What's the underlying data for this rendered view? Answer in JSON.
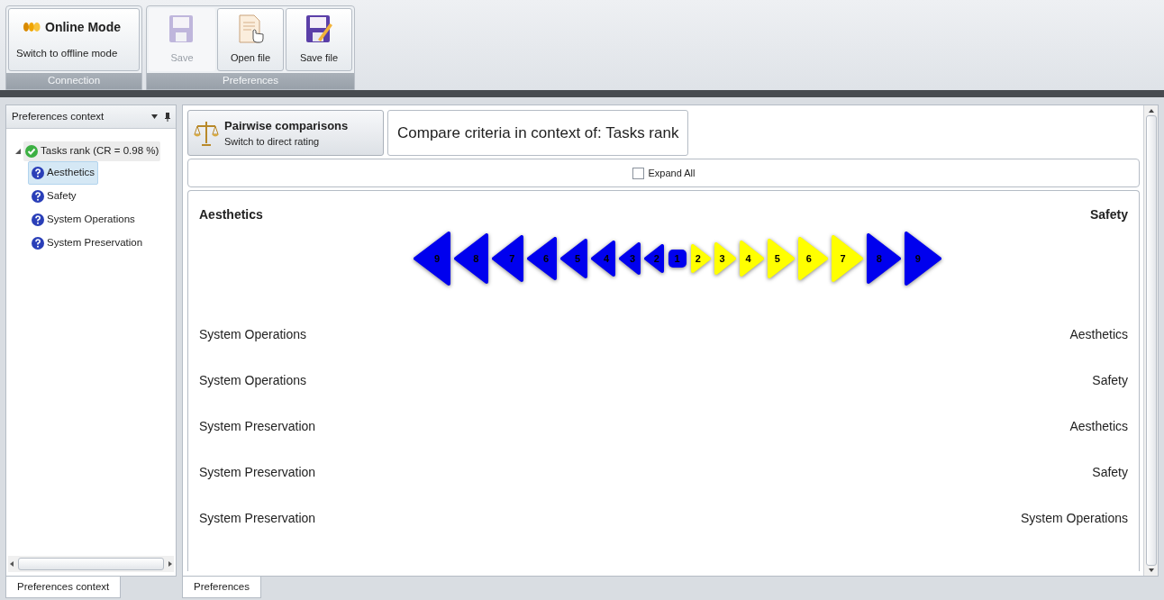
{
  "ribbon": {
    "groups": [
      {
        "label": "Connection",
        "buttons": [
          {
            "kind": "mode",
            "title": "Online Mode",
            "subtitle": "Switch to offline mode",
            "disabled": false
          }
        ]
      },
      {
        "label": "Preferences",
        "buttons": [
          {
            "kind": "floppy",
            "label": "Save",
            "disabled": true
          },
          {
            "kind": "document",
            "label": "Open file",
            "disabled": false
          },
          {
            "kind": "floppy-edit",
            "label": "Save file",
            "disabled": false
          }
        ]
      }
    ]
  },
  "left_panel": {
    "title": "Preferences context",
    "tree": [
      {
        "label": "Tasks rank (CR = 0.98 %)",
        "kind": "ok",
        "expanded": true,
        "selected": false,
        "children": [
          {
            "label": "Aesthetics",
            "kind": "unknown",
            "selected": true
          },
          {
            "label": "Safety",
            "kind": "unknown",
            "selected": false
          },
          {
            "label": "System Operations",
            "kind": "unknown",
            "selected": false
          },
          {
            "label": "System Preservation",
            "kind": "unknown",
            "selected": false
          }
        ]
      }
    ]
  },
  "main": {
    "mode_button": {
      "title": "Pairwise comparisons",
      "subtitle": "Switch to direct rating"
    },
    "context_title": "Compare criteria in context of: Tasks rank",
    "expand_all": {
      "label": "Expand All",
      "checked": false
    },
    "comparisons": [
      {
        "left": "Aesthetics",
        "right": "Safety",
        "expanded": true,
        "scale": [
          {
            "label": "9",
            "kind": "left",
            "color": "#0000ee"
          },
          {
            "label": "8",
            "kind": "left",
            "color": "#0000ee"
          },
          {
            "label": "7",
            "kind": "left",
            "color": "#0000ee"
          },
          {
            "label": "6",
            "kind": "left",
            "color": "#0000ee"
          },
          {
            "label": "5",
            "kind": "left",
            "color": "#0000ee"
          },
          {
            "label": "4",
            "kind": "left",
            "color": "#0000ee"
          },
          {
            "label": "3",
            "kind": "left",
            "color": "#0000ee"
          },
          {
            "label": "2",
            "kind": "left",
            "color": "#0000ee"
          },
          {
            "label": "1",
            "kind": "square",
            "color": "#0000ee"
          },
          {
            "label": "2",
            "kind": "right",
            "color": "#ffff00"
          },
          {
            "label": "3",
            "kind": "right",
            "color": "#ffff00"
          },
          {
            "label": "4",
            "kind": "right",
            "color": "#ffff00"
          },
          {
            "label": "5",
            "kind": "right",
            "color": "#ffff00"
          },
          {
            "label": "6",
            "kind": "right",
            "color": "#ffff00"
          },
          {
            "label": "7",
            "kind": "right",
            "color": "#ffff00"
          },
          {
            "label": "8",
            "kind": "right",
            "color": "#0000ee"
          },
          {
            "label": "9",
            "kind": "right",
            "color": "#0000ee"
          }
        ]
      },
      {
        "left": "System Operations",
        "right": "Aesthetics",
        "expanded": false
      },
      {
        "left": "System Operations",
        "right": "Safety",
        "expanded": false
      },
      {
        "left": "System Preservation",
        "right": "Aesthetics",
        "expanded": false
      },
      {
        "left": "System Preservation",
        "right": "Safety",
        "expanded": false
      },
      {
        "left": "System Preservation",
        "right": "System Operations",
        "expanded": false
      }
    ]
  },
  "bottom_tabs": {
    "left": [
      {
        "label": "Preferences context",
        "selected": true
      }
    ],
    "right": [
      {
        "label": "Preferences",
        "selected": true
      }
    ]
  }
}
